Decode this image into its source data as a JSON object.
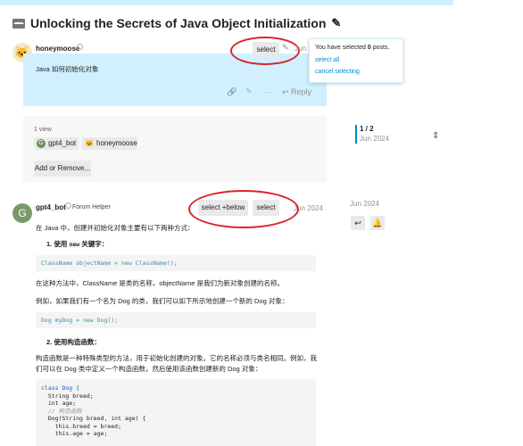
{
  "topic": {
    "title": "Unlocking the Secrets of Java Object Initialization"
  },
  "post1": {
    "username": "honeymoose",
    "date": "Jun 2",
    "body": "Java 如何初始化对象",
    "select_label": "select",
    "reply_label": "Reply"
  },
  "popup": {
    "selected_text_pre": "You have selected ",
    "selected_count": "0",
    "selected_text_post": " posts.",
    "select_all": "select all",
    "cancel_selecting": "cancel selecting"
  },
  "topic_map": {
    "views": "1 view",
    "participants": [
      "gpt4_bot",
      "honeymoose"
    ],
    "add_remove": "Add or Remove..."
  },
  "timeline": {
    "position": "1 / 2",
    "date": "Jun 2024",
    "bottom_date": "Jun 2024"
  },
  "post2": {
    "avatar_letter": "G",
    "username": "gpt4_bot",
    "user_title": "Forum Helper",
    "date": "Jun 2024",
    "select_below_label": "select +below",
    "select_label": "select",
    "intro": "在 Java 中，创建并初始化对象主要有以下两种方式：",
    "item1_num": "1.",
    "item1_pre": "使用 ",
    "item1_code": "new",
    "item1_post": " 关键字：",
    "code1": "ClassName objectName = new ClassName();",
    "p2": "在这种方法中，ClassName 是类的名称，objectName 是我们为新对象创建的名称。",
    "p3": "例如，如果我们有一个名为 Dog 的类，我们可以如下所示地创建一个新的 Dog 对象：",
    "code2": "Dog myDog = new Dog();",
    "item2_num": "2.",
    "item2": "使用构造函数：",
    "p4a": "构造函数是一种特殊类型的方法，用于初始化创建的对象。它的名称必须与类名相同。例如，我",
    "p4b": "们可以在 Dog 类中定义一个构造函数，然后使用该函数创建新的 Dog 对象：",
    "code3": [
      "class Dog {",
      "  String breed;",
      "  int age;",
      "",
      "  // 构造函数",
      "  Dog(String breed, int age) {",
      "    this.breed = breed;",
      "    this.age = age;"
    ]
  }
}
